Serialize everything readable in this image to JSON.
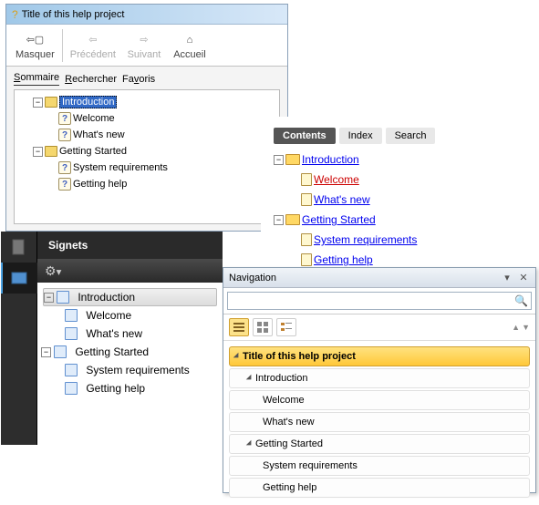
{
  "win1": {
    "title": "Title of this help project",
    "toolbar": {
      "hide": "Masquer",
      "prev": "Précédent",
      "next": "Suivant",
      "home": "Accueil"
    },
    "tabs": {
      "t1": "Sommaire",
      "t2": "Rechercher",
      "t3": "Favoris"
    },
    "tree": {
      "intro": "Introduction",
      "welcome": "Welcome",
      "whatsnew": "What's new",
      "getting": "Getting Started",
      "sysreq": "System requirements",
      "gethelp": "Getting help"
    }
  },
  "win2": {
    "tabs": {
      "contents": "Contents",
      "index": "Index",
      "search": "Search"
    },
    "tree": {
      "intro": "Introduction",
      "welcome": "Welcome",
      "whatsnew": "What's new",
      "getting": "Getting Started",
      "sysreq": "System requirements",
      "gethelp": "Getting help"
    }
  },
  "win3": {
    "header": "Signets",
    "tree": {
      "intro": "Introduction",
      "welcome": "Welcome",
      "whatsnew": "What's new",
      "getting": "Getting Started",
      "sysreq": "System requirements",
      "gethelp": "Getting help"
    }
  },
  "win4": {
    "title": "Navigation",
    "search_placeholder": "",
    "tree": {
      "root": "Title of this help project",
      "intro": "Introduction",
      "welcome": "Welcome",
      "whatsnew": "What's new",
      "getting": "Getting Started",
      "sysreq": "System requirements",
      "gethelp": "Getting help"
    }
  }
}
